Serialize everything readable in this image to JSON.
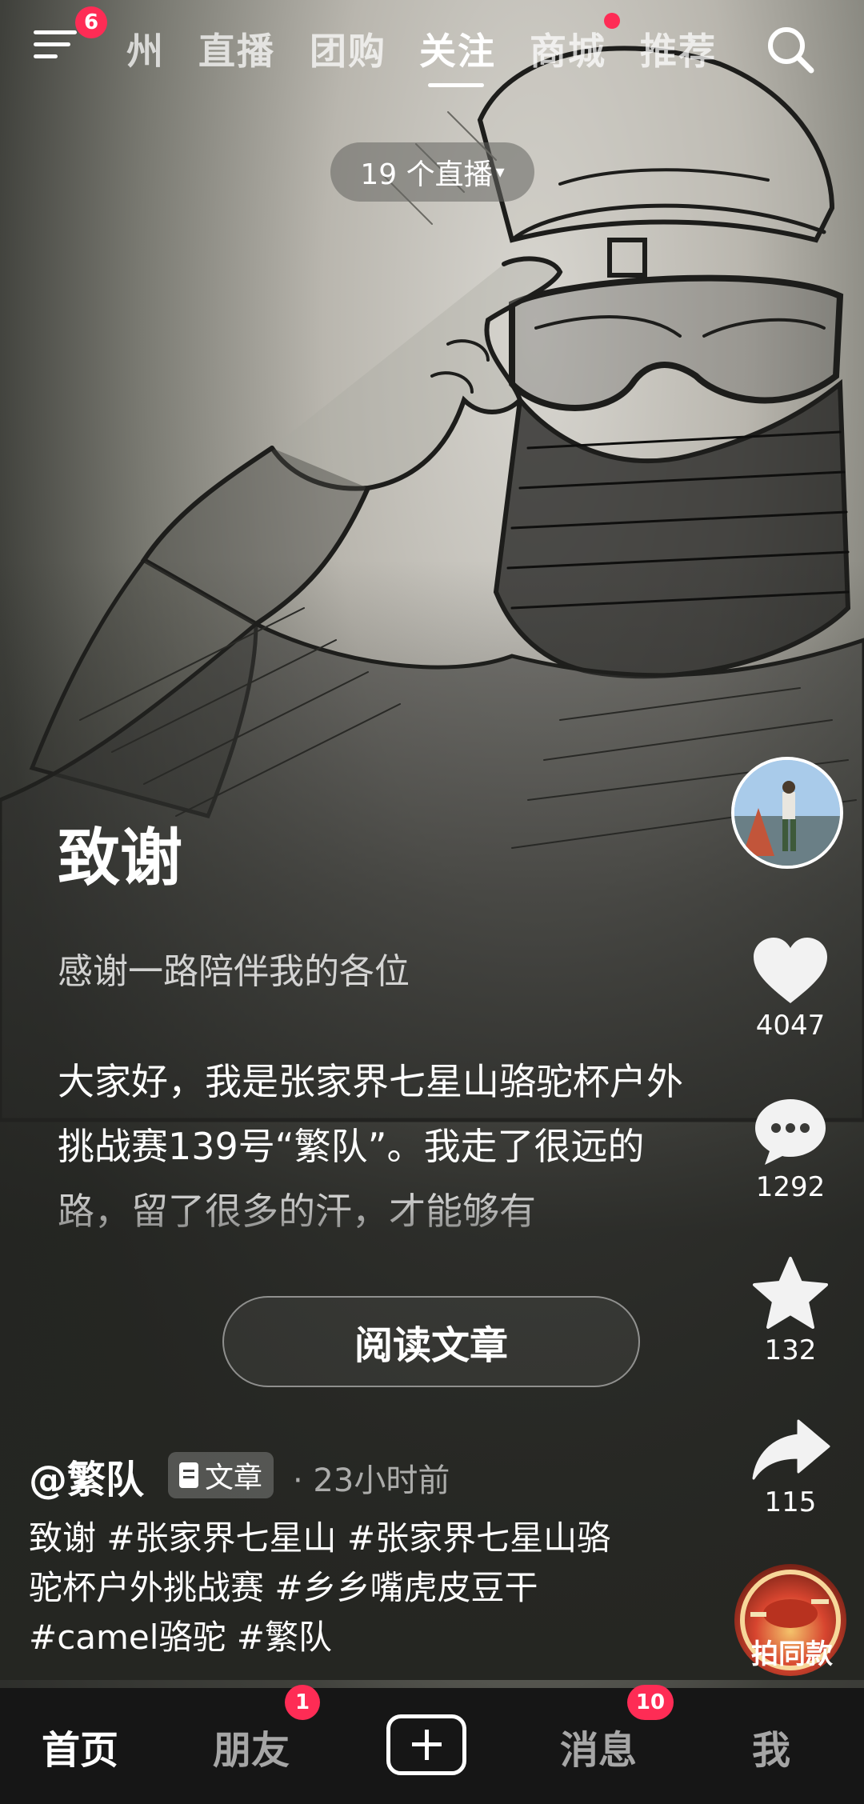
{
  "top_nav": {
    "menu_badge": "6",
    "tabs": [
      {
        "label": "州"
      },
      {
        "label": "直播"
      },
      {
        "label": "团购"
      },
      {
        "label": "关注",
        "active": true
      },
      {
        "label": "商城",
        "has_dot": true
      },
      {
        "label": "推荐"
      }
    ]
  },
  "live_pill": {
    "label": "19 个直播"
  },
  "article": {
    "title": "致谢",
    "subtitle": "感谢一路陪伴我的各位",
    "body": "大家好，我是张家界七星山骆驼杯户外挑战赛139号“繁队”。我走了很远的路，留了很多的汗，才能够有",
    "read_button": "阅读文章"
  },
  "post": {
    "author": "@繁队",
    "type_tag": "文章",
    "time_ago": "· 23小时前",
    "caption": "致谢 #张家界七星山 #张家界七星山骆驼杯户外挑战赛 #乡乡嘴虎皮豆干 #camel骆驼 #繁队"
  },
  "actions": {
    "likes": "4047",
    "comments": "1292",
    "favorites": "132",
    "shares": "115",
    "same_style": "拍同款"
  },
  "bottom_bar": {
    "home": "首页",
    "friends": "朋友",
    "friends_badge": "1",
    "messages": "消息",
    "messages_badge": "10",
    "me": "我"
  },
  "colors": {
    "accent": "#fe2c55",
    "bottom_bar_bg": "#161616"
  }
}
